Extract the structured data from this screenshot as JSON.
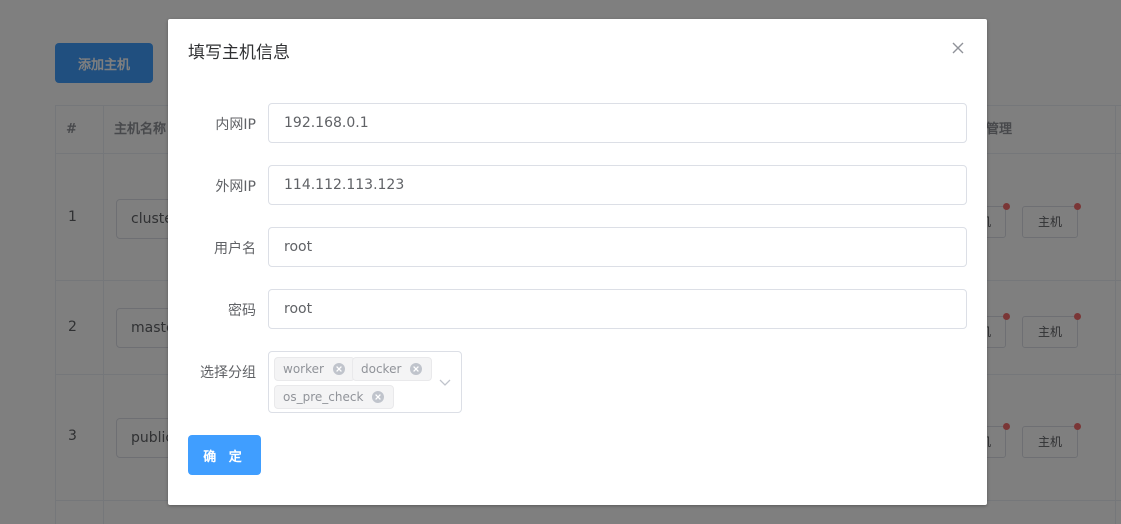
{
  "page": {
    "add_host_label": "添加主机",
    "table": {
      "columns": [
        "#",
        "主机名称",
        "管理"
      ],
      "rows": [
        {
          "index": "1",
          "name": "cluster",
          "btn_a": "主机",
          "btn_b": "主机"
        },
        {
          "index": "2",
          "name": "master",
          "btn_a": "主机",
          "btn_b": "主机"
        },
        {
          "index": "3",
          "name": "public",
          "btn_a": "主机",
          "btn_b": "主机"
        }
      ]
    }
  },
  "dialog": {
    "title": "填写主机信息",
    "fields": {
      "inner_ip": {
        "label": "内网IP",
        "value": "192.168.0.1"
      },
      "outer_ip": {
        "label": "外网IP",
        "value": "114.112.113.123"
      },
      "username": {
        "label": "用户名",
        "value": "root"
      },
      "password": {
        "label": "密码",
        "value": "root"
      },
      "group": {
        "label": "选择分组",
        "tags": [
          "worker",
          "docker",
          "os_pre_check"
        ]
      }
    },
    "confirm_label": "确 定"
  },
  "colors": {
    "primary": "#409eff",
    "overlay": "rgba(0,0,0,0.5)",
    "badge": "#f56c6c"
  },
  "icons": {
    "close": "close-icon",
    "tag_remove": "circle-x-icon",
    "dropdown": "chevron-down-icon"
  }
}
